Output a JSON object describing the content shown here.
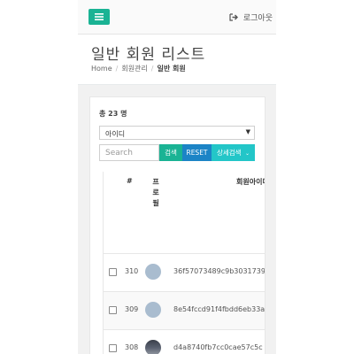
{
  "topbar": {
    "menu_icon": "hamburger-icon",
    "logout_icon": "sign-out-icon",
    "logout_label": "로그아웃"
  },
  "heading": {
    "title": "일반 회원 리스트",
    "breadcrumb": [
      "Home",
      "회원관리",
      "일반 회원"
    ]
  },
  "panel": {
    "total_label": "총 23 명",
    "filter_select": {
      "value": "아이디"
    },
    "search": {
      "placeholder": "Search",
      "search_button": "검색",
      "reset_button": "RESET",
      "detail_button": "상세검색"
    }
  },
  "table": {
    "columns": [
      "#",
      "프로필",
      "회원아이디"
    ],
    "rows": [
      {
        "num": "310",
        "user_id": "36f57073489c9b3031739"
      },
      {
        "num": "309",
        "user_id": "8e54fccd91f4fbdd6eb33a"
      },
      {
        "num": "308",
        "user_id": "d4a8740fb7cc0cae57c5c"
      }
    ]
  },
  "colors": {
    "primary": "#1ab394",
    "reset": "#1c84c6",
    "detail": "#23c6c8"
  }
}
